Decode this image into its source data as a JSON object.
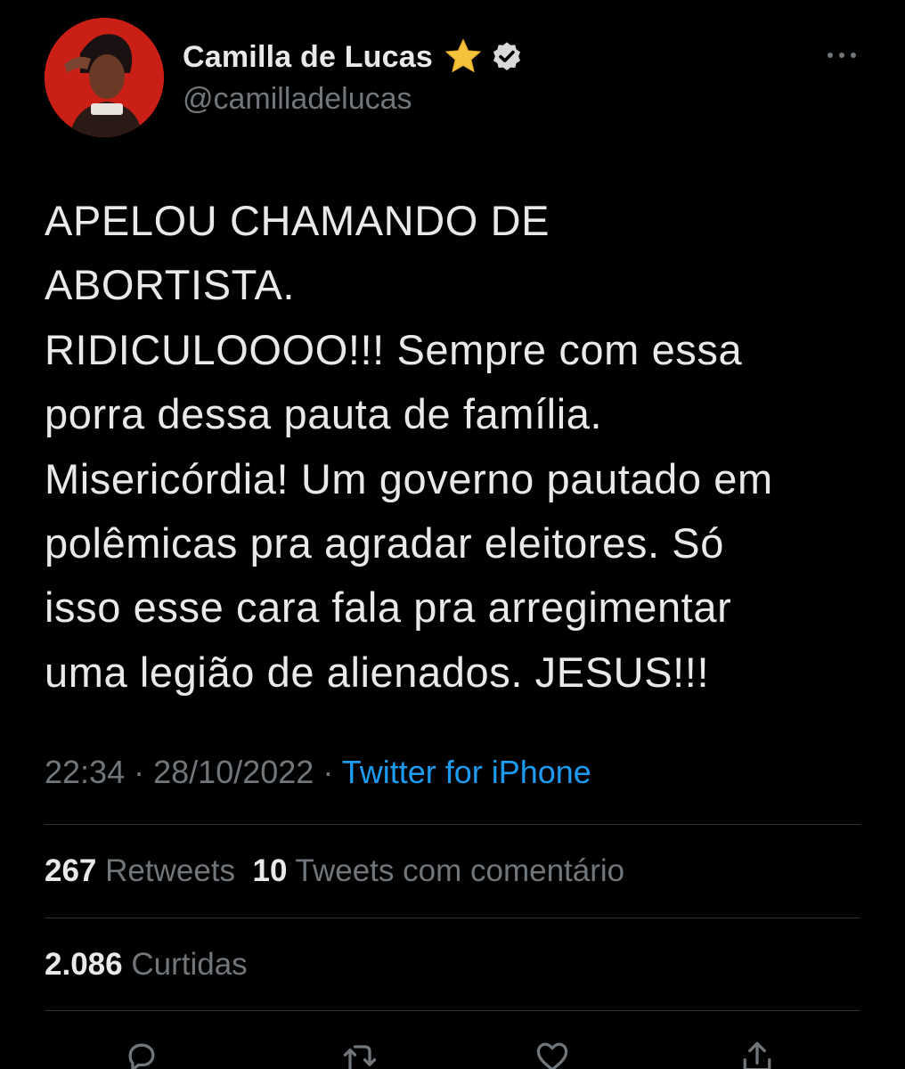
{
  "author": {
    "display_name": "Camilla de Lucas",
    "handle": "@camilladelucas",
    "badges": [
      "star-icon",
      "verified-icon"
    ],
    "avatar_background": "#c91f16"
  },
  "tweet": {
    "lines": [
      "APELOU CHAMANDO DE",
      "ABORTISTA.",
      "RIDICULOOOO!!! Sempre com essa",
      "porra dessa pauta de família.",
      "Misericórdia! Um governo pautado em",
      "polêmicas pra agradar eleitores. Só",
      "isso esse cara fala pra arregimentar",
      "uma legião de alienados. JESUS!!!"
    ],
    "time": "22:34",
    "separator": "·",
    "date": "28/10/2022",
    "source": "Twitter for iPhone"
  },
  "stats": {
    "retweets_count": "267",
    "retweets_label": "Retweets",
    "quotes_count": "10",
    "quotes_label": "Tweets com comentário",
    "likes_count": "2.086",
    "likes_label": "Curtidas"
  },
  "actions": [
    "reply-icon",
    "retweet-icon",
    "like-icon",
    "share-icon"
  ],
  "colors": {
    "background": "#000000",
    "primary_text": "#e7e9ea",
    "secondary_text": "#71767b",
    "link": "#1d9bf0",
    "divider": "#2f3336",
    "star": "#f5c33b"
  }
}
